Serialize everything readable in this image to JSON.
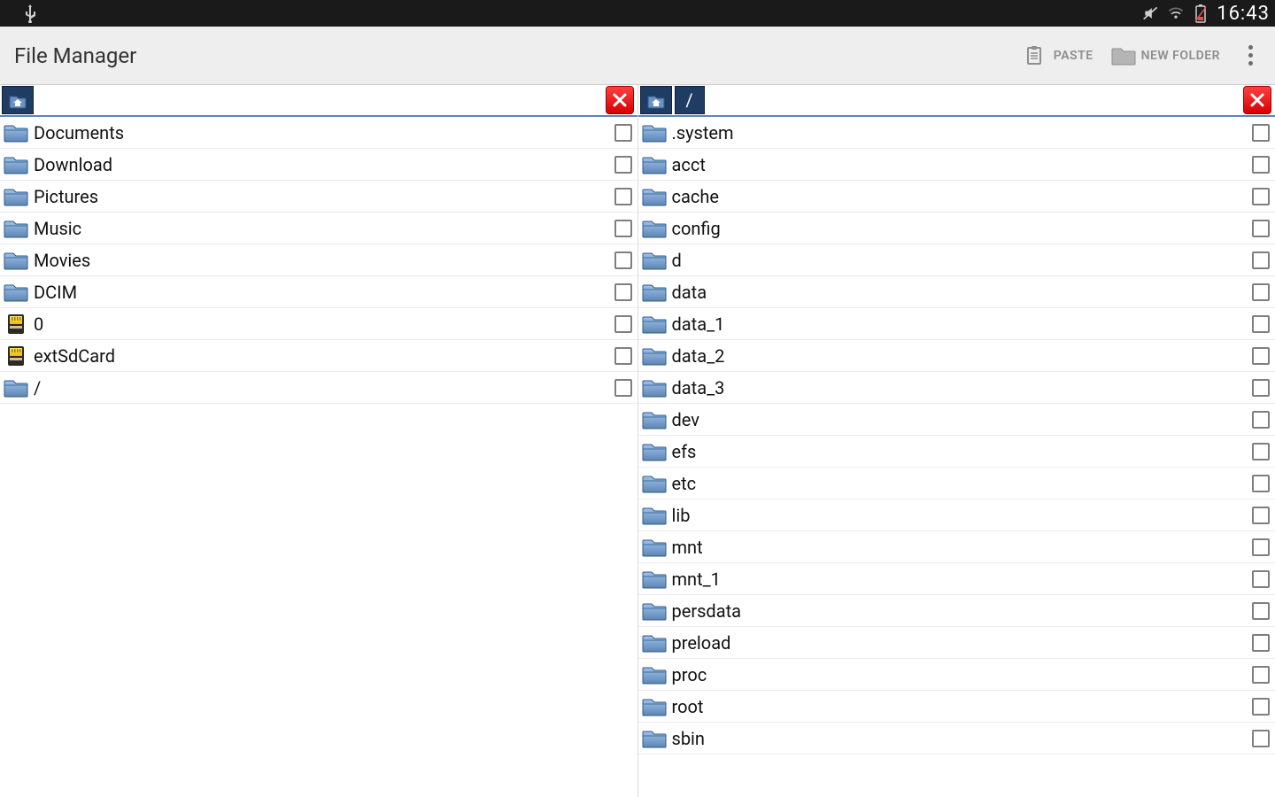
{
  "status": {
    "time": "16:43"
  },
  "actionbar": {
    "title": "File Manager",
    "paste_label": "PASTE",
    "newfolder_label": "NEW FOLDER"
  },
  "panes": {
    "left": {
      "crumbs": [
        {
          "type": "home"
        }
      ],
      "items": [
        {
          "name": "Documents",
          "icon": "folder"
        },
        {
          "name": "Download",
          "icon": "folder"
        },
        {
          "name": "Pictures",
          "icon": "folder"
        },
        {
          "name": "Music",
          "icon": "folder"
        },
        {
          "name": "Movies",
          "icon": "folder"
        },
        {
          "name": "DCIM",
          "icon": "folder"
        },
        {
          "name": "0",
          "icon": "sdcard"
        },
        {
          "name": "extSdCard",
          "icon": "sdcard"
        },
        {
          "name": "/",
          "icon": "folder"
        }
      ]
    },
    "right": {
      "crumbs": [
        {
          "type": "home"
        },
        {
          "type": "path",
          "label": "/"
        }
      ],
      "items": [
        {
          "name": ".system",
          "icon": "folder"
        },
        {
          "name": "acct",
          "icon": "folder"
        },
        {
          "name": "cache",
          "icon": "folder"
        },
        {
          "name": "config",
          "icon": "folder"
        },
        {
          "name": "d",
          "icon": "folder"
        },
        {
          "name": "data",
          "icon": "folder"
        },
        {
          "name": "data_1",
          "icon": "folder"
        },
        {
          "name": "data_2",
          "icon": "folder"
        },
        {
          "name": "data_3",
          "icon": "folder"
        },
        {
          "name": "dev",
          "icon": "folder"
        },
        {
          "name": "efs",
          "icon": "folder"
        },
        {
          "name": "etc",
          "icon": "folder"
        },
        {
          "name": "lib",
          "icon": "folder"
        },
        {
          "name": "mnt",
          "icon": "folder"
        },
        {
          "name": "mnt_1",
          "icon": "folder"
        },
        {
          "name": "persdata",
          "icon": "folder"
        },
        {
          "name": "preload",
          "icon": "folder"
        },
        {
          "name": "proc",
          "icon": "folder"
        },
        {
          "name": "root",
          "icon": "folder"
        },
        {
          "name": "sbin",
          "icon": "folder"
        }
      ]
    }
  }
}
